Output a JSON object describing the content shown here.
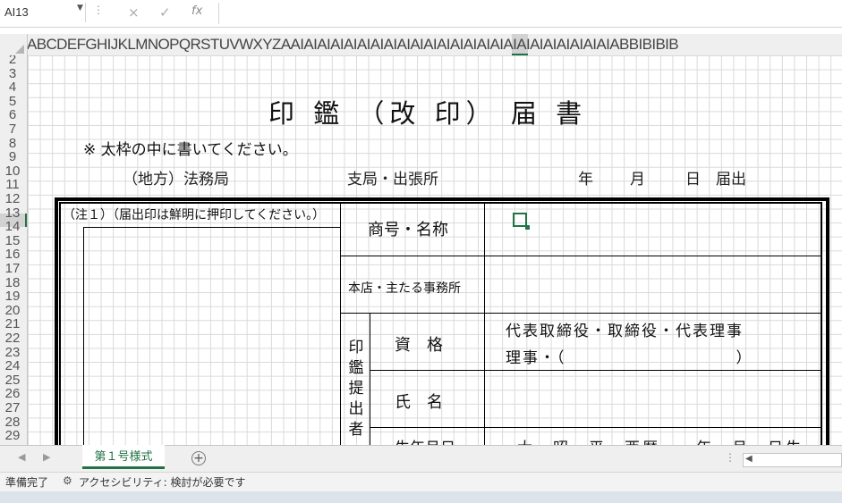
{
  "formula_bar": {
    "name_box": "AI13",
    "cancel_icon": "×",
    "enter_icon": "✓",
    "function_icon": "fx",
    "formula_value": ""
  },
  "columns": {
    "letters": "ABCDEFGHIJKLMNOPQRSTUVWXYZAAIAIAIAIAIAIAIAIAIAIAIAIAIAIAIAIAIAIAIAIAIAIAIAIABBIBIBIB",
    "selected": "AI"
  },
  "rows": [
    "2",
    "3",
    "4",
    "5",
    "6",
    "7",
    "8",
    "9",
    "10",
    "11",
    "12",
    "13",
    "14",
    "15",
    "16",
    "17",
    "18",
    "19",
    "20",
    "21",
    "22",
    "23",
    "24",
    "25",
    "26",
    "27",
    "28",
    "29"
  ],
  "selected_row": "13",
  "form": {
    "title": "印 鑑 （改 印） 届 書",
    "note": "※ 太枠の中に書いてください。",
    "bureau": "（地方）法務局",
    "branch": "支局・出張所",
    "year": "年",
    "month": "月",
    "day_submit": "日　届出",
    "note1": "（注１）（届出印は鮮明に押印してください。）",
    "trade_name_label": "商号・名称",
    "head_office_label": "本店・主たる事務所",
    "submitter_label": "印鑑提出者",
    "qualification_label": "資　格",
    "qualification_line1": "代表取締役・取締役・代表理事",
    "qualification_line2": "理事・（　　　　　　　　　　）",
    "name_label": "氏　名",
    "birth_label": "生年月日",
    "birth_value": "大・昭・平・西暦　　年　月　日生"
  },
  "sheet_tabs": [
    {
      "label": "第１号様式",
      "active": true
    }
  ],
  "status": {
    "ready": "準備完了",
    "accessibility": "アクセシビリティ: 検討が必要です"
  },
  "colors": {
    "accent": "#217346",
    "grid": "#d9d9d9",
    "header_bg": "#efefef"
  }
}
